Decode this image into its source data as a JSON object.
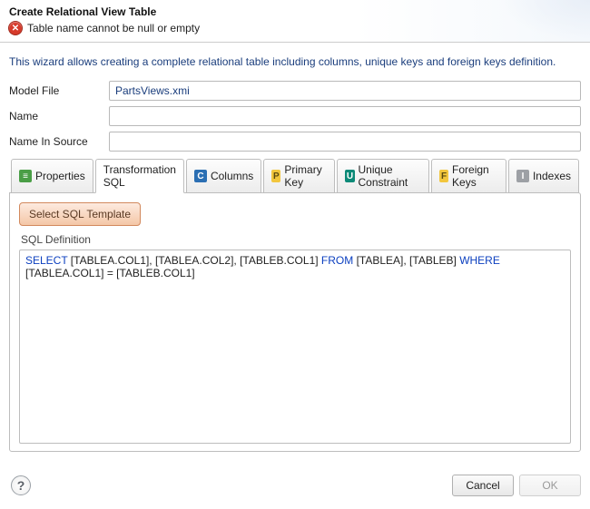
{
  "header": {
    "title": "Create Relational View Table",
    "error_message": "Table name cannot be null or empty"
  },
  "instruction": "This wizard allows creating a complete relational table including columns, unique keys and foreign keys definition.",
  "fields": {
    "model_file": {
      "label": "Model File",
      "value": "PartsViews.xmi"
    },
    "name": {
      "label": "Name",
      "value": ""
    },
    "name_in_source": {
      "label": "Name In Source",
      "value": ""
    }
  },
  "tabs": {
    "properties": "Properties",
    "transformation_sql": "Transformation SQL",
    "columns": "Columns",
    "primary_key": "Primary Key",
    "unique_constraint": "Unique Constraint",
    "foreign_keys": "Foreign Keys",
    "indexes": "Indexes",
    "active_index": 1
  },
  "sql_panel": {
    "select_template_label": "Select SQL Template",
    "definition_label": "SQL Definition",
    "sql_tokens": {
      "select": "SELECT",
      "cols": " [TABLEA.COL1], [TABLEA.COL2], [TABLEB.COL1] ",
      "from": "FROM",
      "tables": " [TABLEA], [TABLEB] ",
      "where": "WHERE",
      "cond": " [TABLEA.COL1] = [TABLEB.COL1]"
    }
  },
  "footer": {
    "cancel": "Cancel",
    "ok": "OK"
  }
}
